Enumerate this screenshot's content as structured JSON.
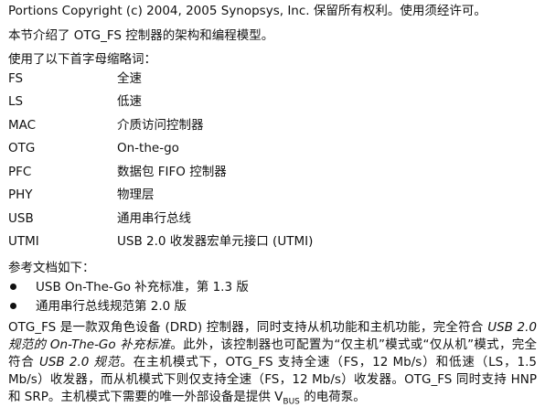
{
  "copyright": "Portions Copyright (c) 2004, 2005 Synopsys, Inc. 保留所有权利。使用须经许可。",
  "intro": "本节介绍了 OTG_FS 控制器的架构和编程模型。",
  "abbr_heading": "使用了以下首字母缩略词：",
  "abbreviations": [
    {
      "term": "FS",
      "definition": "全速"
    },
    {
      "term": "LS",
      "definition": "低速"
    },
    {
      "term": "MAC",
      "definition": "介质访问控制器"
    },
    {
      "term": "OTG",
      "definition": "On-the-go"
    },
    {
      "term": "PFC",
      "definition": "数据包 FIFO 控制器"
    },
    {
      "term": "PHY",
      "definition": "物理层"
    },
    {
      "term": "USB",
      "definition": "通用串行总线"
    },
    {
      "term": "UTMI",
      "definition": "USB 2.0 收发器宏单元接口 (UTMI)"
    }
  ],
  "refs_heading": "参考文档如下：",
  "references": [
    "USB On-The-Go 补充标准，第 1.3 版",
    "通用串行总线规范第 2.0 版"
  ],
  "paragraph": {
    "p1": "OTG_FS 是一款双角色设备 (DRD) 控制器，同时支持从机功能和主机功能，完全符合 ",
    "i1": "USB 2.0 规范的 On-The-Go 补充标准",
    "p2": "。此外，该控制器也可配置为“仅主机”模式或“仅从机”模式，完全符合 ",
    "i2": "USB 2.0 规范",
    "p3": "。在主机模式下，OTG_FS 支持全速（FS，12 Mb/s）和低速（LS，1.5 Mb/s）收发器，而从机模式下则仅支持全速（FS，12 Mb/s）收发器。OTG_FS 同时支持 HNP 和 SRP。主机模式下需要的唯一外部设备是提供 V",
    "sub": "BUS",
    "p4": " 的电荷泵。"
  }
}
